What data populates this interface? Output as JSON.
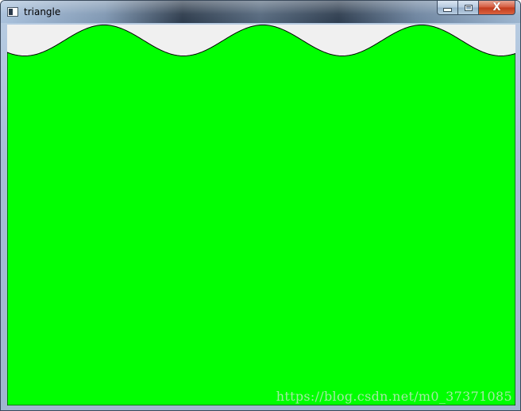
{
  "window": {
    "title": "triangle",
    "icons": {
      "app": "app-window-icon",
      "minimize": "minimize-icon",
      "maximize": "maximize-icon",
      "close": "close-icon"
    },
    "close_glyph": "X"
  },
  "canvas": {
    "background_color": "#f0f0f0",
    "fill_color": "#00ff00",
    "outline_color": "#000000",
    "shape": "sine-wave-topped-rectangle"
  },
  "watermark": {
    "text": "https://blog.csdn.net/m0_37371085"
  }
}
